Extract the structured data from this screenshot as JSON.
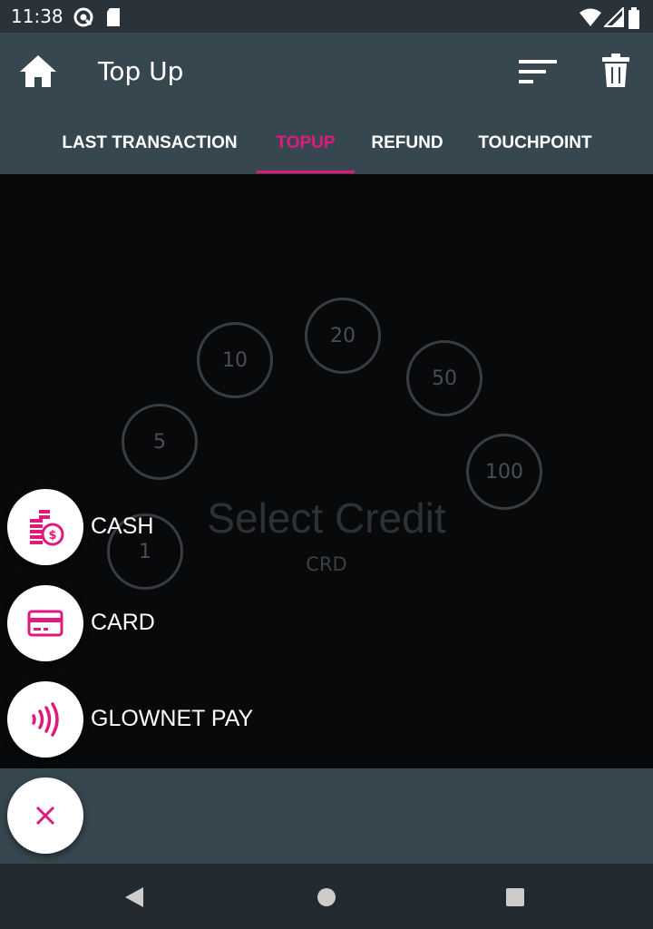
{
  "status_bar": {
    "time": "11:38"
  },
  "app_bar": {
    "title": "Top Up"
  },
  "tabs": [
    {
      "label": "LAST TRANSACTION"
    },
    {
      "label": "TOPUP"
    },
    {
      "label": "REFUND"
    },
    {
      "label": "TOUCHPOINT"
    }
  ],
  "active_tab": "TOPUP",
  "credits": [
    "1",
    "5",
    "10",
    "20",
    "50",
    "100"
  ],
  "prompt": {
    "title": "Select Credit",
    "currency": "CRD"
  },
  "payment_options": [
    {
      "label": "CASH",
      "icon": "cash-coins-icon"
    },
    {
      "label": "CARD",
      "icon": "credit-card-icon"
    },
    {
      "label": "GLOWNET PAY",
      "icon": "contactless-icon"
    }
  ],
  "close_fab": {
    "icon": "close-icon"
  },
  "colors": {
    "accent": "#e0197d",
    "app_bar": "#37474f",
    "background": "#08090a"
  }
}
